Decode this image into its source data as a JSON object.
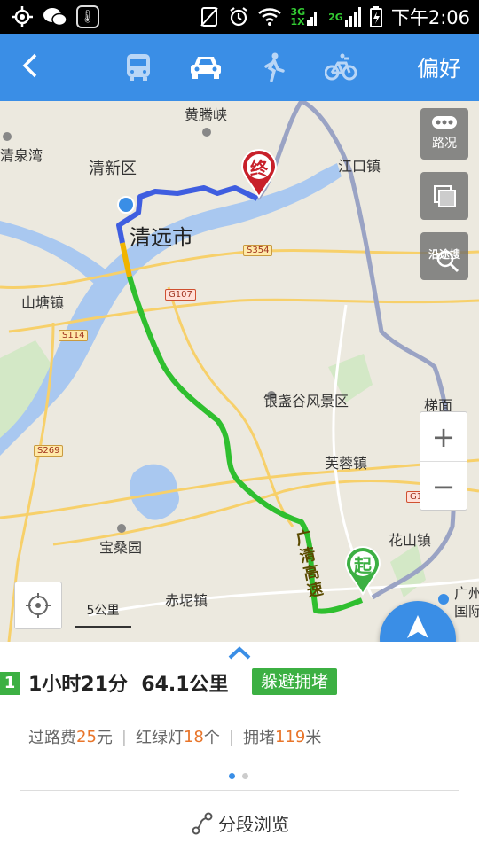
{
  "status_bar": {
    "network_3g": "3G",
    "network_1x": "1X",
    "network_2g": "2G",
    "time": "下午2:06"
  },
  "header": {
    "back_icon": "chevron-left-icon",
    "modes": [
      {
        "name": "bus",
        "icon": "bus-icon",
        "active": false
      },
      {
        "name": "car",
        "icon": "car-icon",
        "active": true
      },
      {
        "name": "walk",
        "icon": "walk-icon",
        "active": false
      },
      {
        "name": "bike",
        "icon": "bike-icon",
        "active": false
      }
    ],
    "preference_label": "偏好"
  },
  "map": {
    "places": {
      "huangtengxia": "黄腾峡",
      "qingquanwan": "清泉湾",
      "qingxinqu": "清新区",
      "jiangkouzhen": "江口镇",
      "qingyuanshi": "清远市",
      "shantangzhen": "山塘镇",
      "yinzhangu": "银盏谷风景区",
      "futongzhen": "芙蓉镇",
      "baosangyuan": "宝桑园",
      "chinizhen": "赤坭镇",
      "huashanzhen": "花山镇",
      "timian": "梯面",
      "guangzhou": "广州",
      "guangzhou2": "国际"
    },
    "roads": {
      "s354": "S354",
      "g107": "G107",
      "s114": "S114",
      "s269": "S269",
      "g1": "G1",
      "expressway": "广清高速"
    },
    "markers": {
      "end": "终",
      "start": "起"
    },
    "traffic_label": "路况",
    "search_along_label": "沿途搜",
    "zoom_in": "+",
    "zoom_out": "−",
    "scale_label": "5公里",
    "navigate_label": "导航",
    "colors": {
      "route_green": "#2fbf2f",
      "route_blue": "#3f5ee0",
      "route_yellow": "#f0b400",
      "water": "#a9c8f0",
      "accent": "#3a8ee6"
    }
  },
  "route": {
    "index": "1",
    "duration": "1小时21分",
    "distance": "64.1公里",
    "tag": "躲避拥堵",
    "toll_label": "过路费",
    "toll_value": "25",
    "toll_unit": "元",
    "lights_label": "红绿灯",
    "lights_value": "18",
    "lights_unit": "个",
    "jam_label": "拥堵",
    "jam_value": "119",
    "jam_unit": "米",
    "segment_view_label": "分段浏览"
  }
}
